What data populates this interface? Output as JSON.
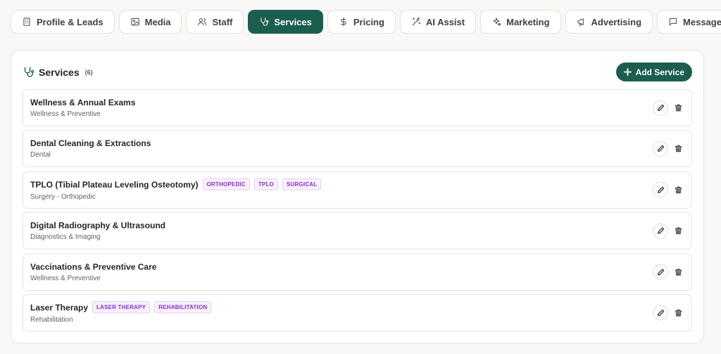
{
  "tabs": [
    {
      "label": "Profile & Leads",
      "icon": "building-icon",
      "active": false
    },
    {
      "label": "Media",
      "icon": "image-icon",
      "active": false
    },
    {
      "label": "Staff",
      "icon": "users-icon",
      "active": false
    },
    {
      "label": "Services",
      "icon": "stethoscope-icon",
      "active": true
    },
    {
      "label": "Pricing",
      "icon": "dollar-icon",
      "active": false
    },
    {
      "label": "AI Assist",
      "icon": "wand-icon",
      "active": false
    },
    {
      "label": "Marketing",
      "icon": "sparkles-icon",
      "active": false
    },
    {
      "label": "Advertising",
      "icon": "megaphone-icon",
      "active": false
    },
    {
      "label": "Messages",
      "icon": "message-icon",
      "active": false
    }
  ],
  "services_panel": {
    "title": "Services",
    "count": "(6)",
    "add_label": "Add Service",
    "items": [
      {
        "name": "Wellness & Annual Exams",
        "category": "Wellness & Preventive",
        "tags": []
      },
      {
        "name": "Dental Cleaning & Extractions",
        "category": "Dental",
        "tags": []
      },
      {
        "name": "TPLO (Tibial Plateau Leveling Osteotomy)",
        "category": "Surgery - Orthopedic",
        "tags": [
          "ORTHOPEDIC",
          "TPLO",
          "SURGICAL"
        ]
      },
      {
        "name": "Digital Radiography & Ultrasound",
        "category": "Diagnostics & Imaging",
        "tags": []
      },
      {
        "name": "Vaccinations & Preventive Care",
        "category": "Wellness & Preventive",
        "tags": []
      },
      {
        "name": "Laser Therapy",
        "category": "Rehabilitation",
        "tags": [
          "LASER THERAPY",
          "REHABILITATION"
        ]
      }
    ]
  },
  "colors": {
    "accent": "#1b5e4f",
    "tag_text": "#8a2fc9",
    "tag_bg": "#f8f1fd"
  }
}
